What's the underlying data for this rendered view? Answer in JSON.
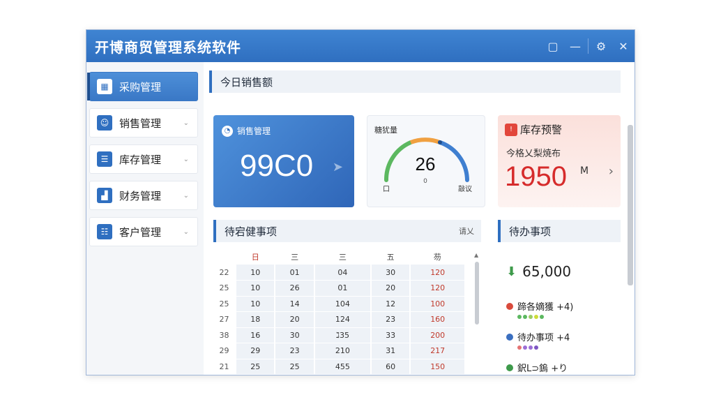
{
  "window": {
    "title": "开博商贸管理系统软件"
  },
  "titlebar_icons": [
    "restore-icon",
    "minimize-icon",
    "settings-icon",
    "close-icon"
  ],
  "sidebar": {
    "items": [
      {
        "label": "采购管理",
        "icon": "grid-icon",
        "active": true
      },
      {
        "label": "销售管理",
        "icon": "person-icon"
      },
      {
        "label": "库存管理",
        "icon": "warehouse-icon"
      },
      {
        "label": "财务管理",
        "icon": "chart-icon"
      },
      {
        "label": "客户管理",
        "icon": "customer-icon"
      }
    ]
  },
  "today_sales": {
    "header": "今日销售额",
    "blue_card": {
      "label": "销售管理",
      "value": "99C0"
    },
    "gauge": {
      "label": "糖犹量",
      "value": "26",
      "left": "口",
      "right": "敲议",
      "mid": "0"
    },
    "warning": {
      "title": "库存预警",
      "subtitle": "今格乂梨焼布",
      "value": "1950",
      "unit": "M"
    }
  },
  "table_section": {
    "header": "待宕健事项",
    "action": "请乂",
    "columns": [
      "",
      "日",
      "三",
      "三",
      "五",
      "芴"
    ],
    "rows": [
      [
        "22",
        "10",
        "01",
        "04",
        "30",
        "120"
      ],
      [
        "25",
        "10",
        "26",
        "01",
        "20",
        "120"
      ],
      [
        "25",
        "10",
        "14",
        "104",
        "12",
        "100"
      ],
      [
        "27",
        "18",
        "20",
        "124",
        "23",
        "160"
      ],
      [
        "38",
        "16",
        "30",
        "ℷ35",
        "33",
        "200"
      ],
      [
        "29",
        "29",
        "23",
        "210",
        "31",
        "217"
      ],
      [
        "21",
        "25",
        "25",
        "455",
        "60",
        "150"
      ]
    ]
  },
  "todo": {
    "header": "待办事项",
    "total": "65,000",
    "items": [
      {
        "label": "蹄各嫡獲 +4)",
        "color": "#d94a3c"
      },
      {
        "label": "待办事项 +4",
        "color": "#3b6fc0"
      },
      {
        "label": "鈬L⊃鎢 +り",
        "color": "#3e9a4b"
      }
    ]
  },
  "colors": {
    "accent": "#2f6fc0",
    "warning": "#d62b2b",
    "gauge_green": "#5cb860",
    "gauge_orange": "#f0a040",
    "gauge_blue": "#3f7fd0"
  }
}
